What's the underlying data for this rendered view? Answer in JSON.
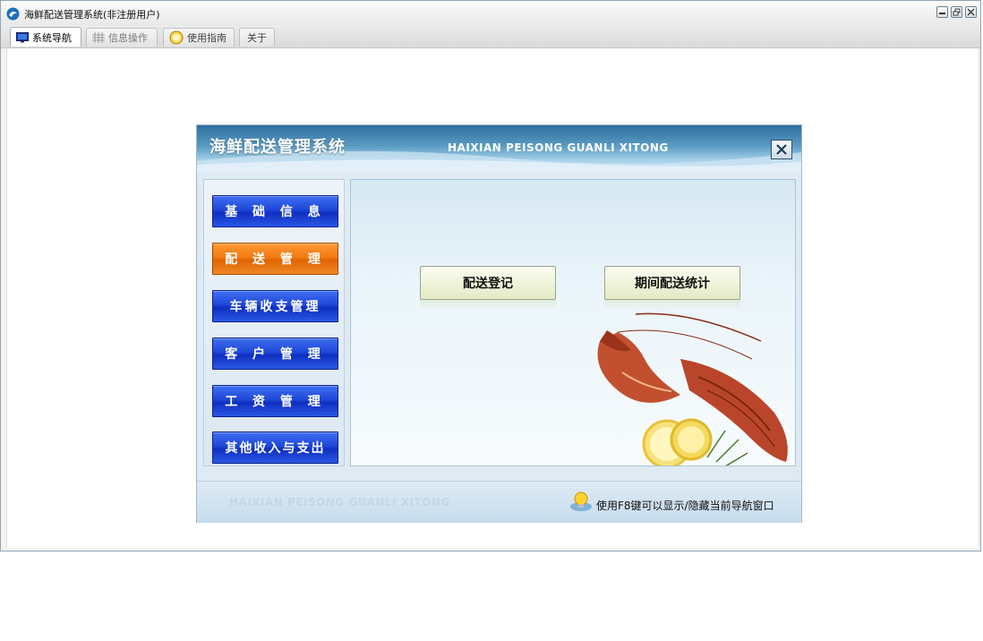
{
  "window": {
    "title": "海鲜配送管理系统(非注册用户)"
  },
  "tabs": [
    {
      "label": "系统导航",
      "icon": "monitor-icon",
      "active": true
    },
    {
      "label": "信息操作",
      "icon": "grid-icon",
      "active": false
    },
    {
      "label": "使用指南",
      "icon": "help-icon",
      "active": false
    },
    {
      "label": "关于",
      "icon": "",
      "active": false
    }
  ],
  "panel": {
    "title_cn": "海鲜配送管理系统",
    "title_en": "HAIXIAN PEISONG GUANLI XITONG",
    "footer_en": "HAIXIAN PEISONG GUANLI XITONG",
    "footer_tip": "使用F8键可以显示/隐藏当前导航窗口"
  },
  "nav": [
    {
      "label": "基 础 信 息"
    },
    {
      "label": "配 送 管 理"
    },
    {
      "label": "车辆收支管理"
    },
    {
      "label": "客 户 管 理"
    },
    {
      "label": "工 资 管 理"
    },
    {
      "label": "其他收入与支出"
    }
  ],
  "actions": [
    {
      "label": "配送登记"
    },
    {
      "label": "期间配送统计"
    }
  ],
  "colors": {
    "nav_blue": "#1f47d8",
    "nav_active_orange": "#f17a12",
    "header_blue": "#2f6f9e"
  }
}
